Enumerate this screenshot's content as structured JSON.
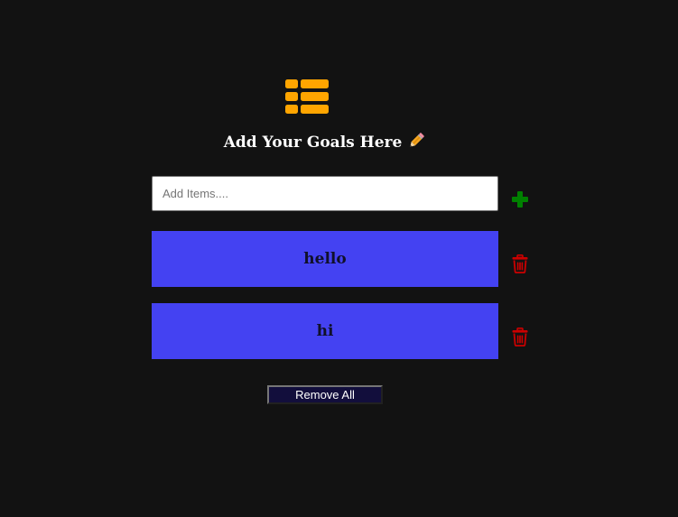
{
  "header": {
    "logo_icon": "list-icon",
    "title": "Add Your Goals Here",
    "title_icon": "pencil-icon"
  },
  "input": {
    "placeholder": "Add Items....",
    "value": "",
    "add_icon": "plus-icon"
  },
  "items": [
    {
      "label": "hello",
      "delete_icon": "trash-icon"
    },
    {
      "label": "hi",
      "delete_icon": "trash-icon"
    }
  ],
  "actions": {
    "remove_all_label": "Remove All"
  },
  "colors": {
    "background": "#121212",
    "accent": "#ffa500",
    "item_background": "#4442f2",
    "add": "#008000",
    "delete": "#cc0000",
    "button_background": "#120e3c"
  }
}
